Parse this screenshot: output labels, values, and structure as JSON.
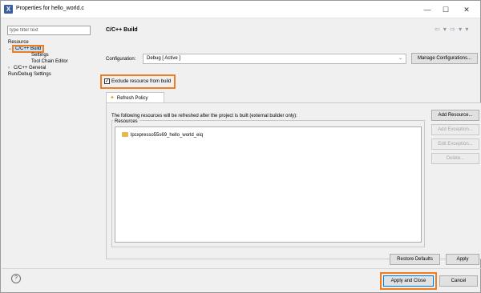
{
  "window": {
    "title": "Properties for hello_world.c",
    "minimize": "—",
    "maximize": "☐",
    "close": "✕"
  },
  "filter": {
    "placeholder": "type filter text"
  },
  "tree": {
    "items": [
      {
        "label": "Resource",
        "arrow": ""
      },
      {
        "label": "C/C++ Build",
        "arrow": "⌄"
      },
      {
        "label": "Settings",
        "arrow": ""
      },
      {
        "label": "Tool Chain Editor",
        "arrow": ""
      },
      {
        "label": "C/C++ General",
        "arrow": "›"
      },
      {
        "label": "Run/Debug Settings",
        "arrow": ""
      }
    ]
  },
  "page": {
    "title": "C/C++ Build",
    "nav": "⇦ ▾ ⇨ ▾ ▾"
  },
  "configuration": {
    "label": "Configuration:",
    "value": "Debug [ Active ]",
    "caret": "⌄",
    "manage_label": "Manage Configurations..."
  },
  "exclude": {
    "checked": "✓",
    "label": "Exclude resource from build"
  },
  "tabs": [
    {
      "label": "Refresh Policy",
      "icon": "refresh-icon"
    }
  ],
  "refresh": {
    "description": "The following resources will be refreshed after the project is built (external builder only):",
    "group_title": "Resources",
    "resources": [
      "lpcxpresso55s69_hello_world_eiq"
    ],
    "buttons": {
      "add_resource": "Add Resource...",
      "add_exception": "Add Exception...",
      "edit_exception": "Edit Exception...",
      "delete": "Delete..."
    }
  },
  "actions": {
    "restore_defaults": "Restore Defaults",
    "apply": "Apply",
    "apply_and_close": "Apply and Close",
    "cancel": "Cancel",
    "help": "?"
  },
  "colors": {
    "highlight": "#ef7d22",
    "selection": "#cce4f7",
    "folder": "#e8b84b"
  }
}
